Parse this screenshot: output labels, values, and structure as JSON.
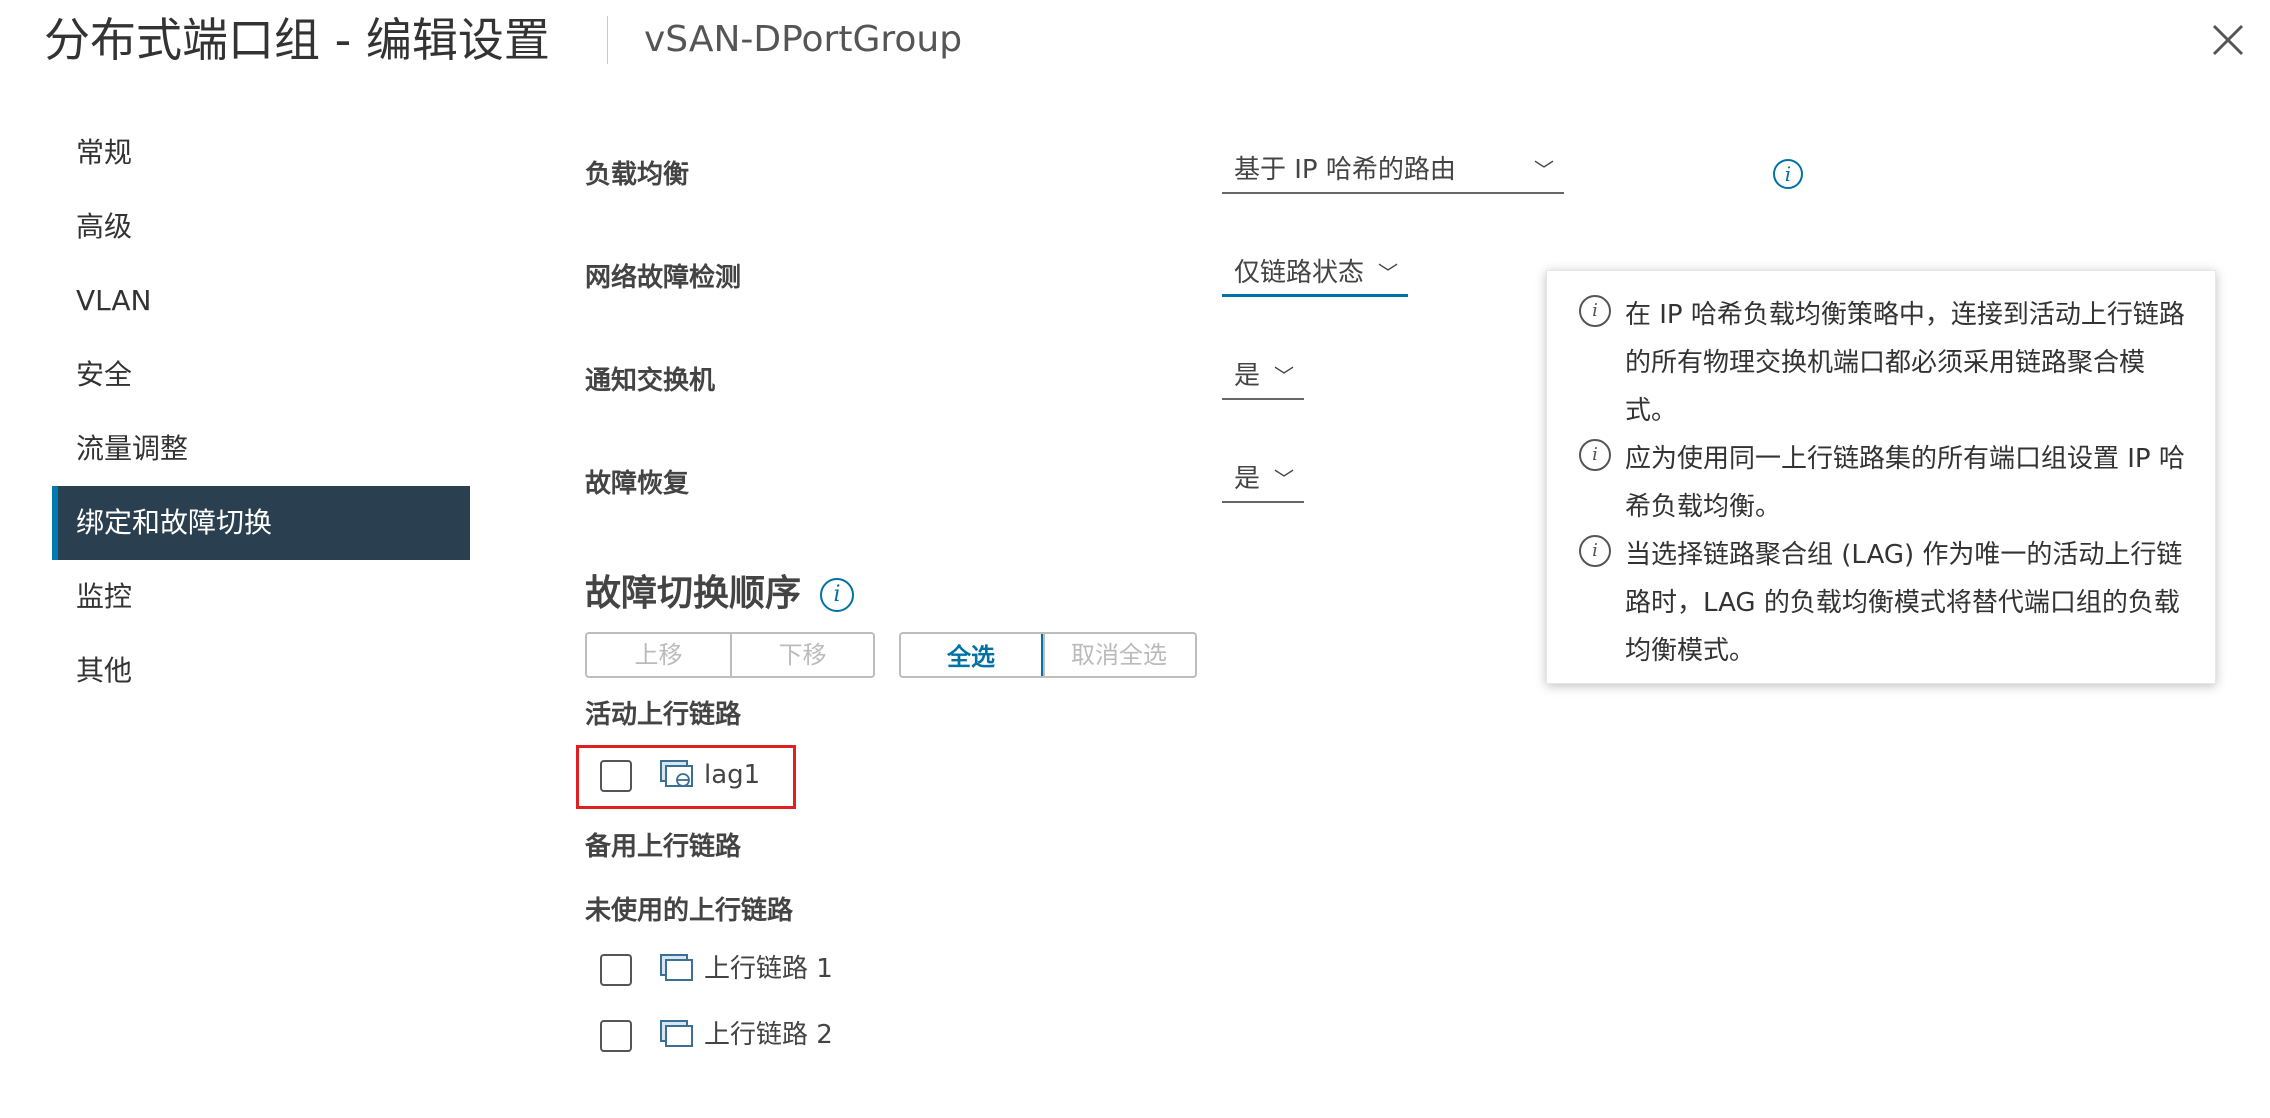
{
  "header": {
    "title": "分布式端口组 - 编辑设置",
    "subtitle": "vSAN-DPortGroup"
  },
  "sidebar": {
    "items": [
      {
        "label": "常规",
        "active": false
      },
      {
        "label": "高级",
        "active": false
      },
      {
        "label": "VLAN",
        "active": false
      },
      {
        "label": "安全",
        "active": false
      },
      {
        "label": "流量调整",
        "active": false
      },
      {
        "label": "绑定和故障切换",
        "active": true
      },
      {
        "label": "监控",
        "active": false
      },
      {
        "label": "其他",
        "active": false
      }
    ]
  },
  "settings": {
    "load_balancing": {
      "label": "负载均衡",
      "value": "基于 IP 哈希的路由"
    },
    "failure_detection": {
      "label": "网络故障检测",
      "value": "仅链路状态"
    },
    "notify_switches": {
      "label": "通知交换机",
      "value": "是"
    },
    "failback": {
      "label": "故障恢复",
      "value": "是"
    }
  },
  "tooltip": {
    "items": [
      "在 IP 哈希负载均衡策略中，连接到活动上行链路的所有物理交换机端口都必须采用链路聚合模式。",
      "应为使用同一上行链路集的所有端口组设置 IP 哈希负载均衡。",
      "当选择链路聚合组 (LAG) 作为唯一的活动上行链路时，LAG 的负载均衡模式将替代端口组的负载均衡模式。"
    ]
  },
  "failover": {
    "title": "故障切换顺序",
    "buttons": {
      "move_up": "上移",
      "move_down": "下移",
      "select_all": "全选",
      "deselect_all": "取消全选"
    },
    "active_label": "活动上行链路",
    "active_uplinks": [
      "lag1"
    ],
    "standby_label": "备用上行链路",
    "unused_label": "未使用的上行链路",
    "unused_uplinks": [
      "上行链路 1",
      "上行链路 2"
    ]
  },
  "icons": {
    "close": "close-icon",
    "info": "info-icon",
    "chevron": "chevron-down-icon",
    "uplink": "uplink-icon",
    "lag": "lag-icon"
  },
  "colors": {
    "accent": "#0072a3",
    "active_nav_bg": "#2a3f4f",
    "highlight": "#e02020"
  }
}
